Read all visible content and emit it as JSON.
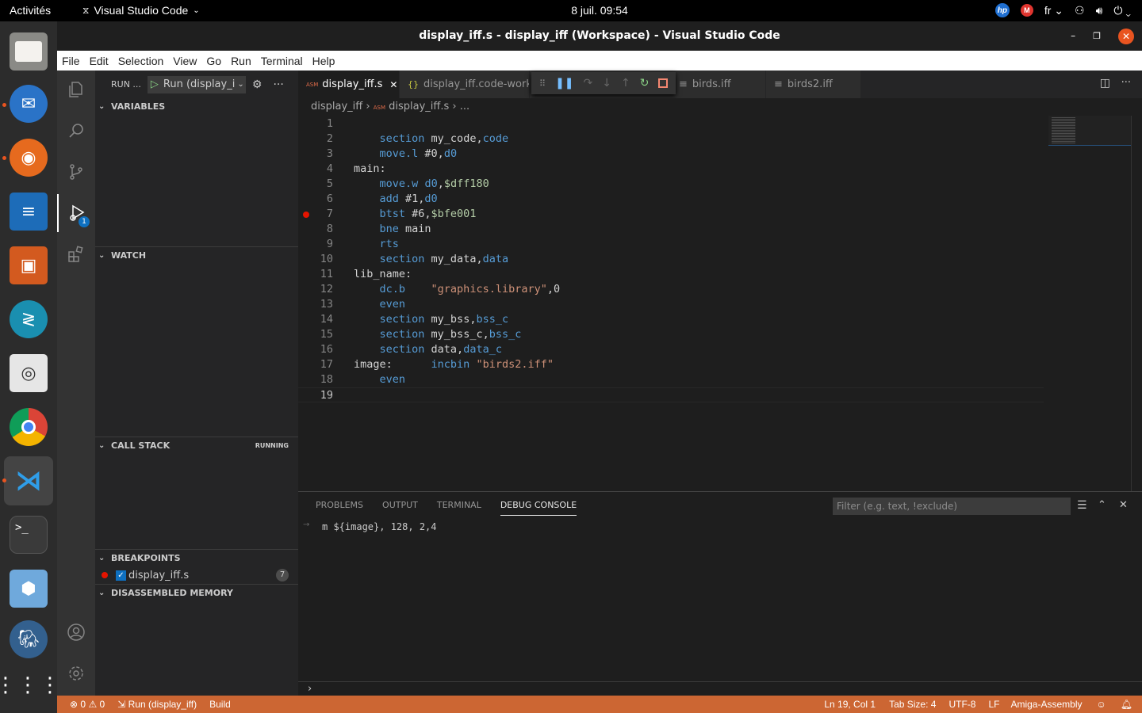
{
  "system_bar": {
    "activities": "Activités",
    "app_name": "Visual Studio Code",
    "clock": "8 juil.  09:54",
    "lang": "fr"
  },
  "dock": {
    "apps": [
      "files-icon",
      "thunderbird-icon",
      "firefox-icon",
      "writer-icon",
      "impress-icon",
      "remote-desktop-icon",
      "document-viewer-icon",
      "chrome-icon",
      "vscode-icon",
      "terminal-icon",
      "virtualbox-icon",
      "pgadmin-icon",
      "show-apps-icon"
    ]
  },
  "window": {
    "title": "display_iff.s - display_iff (Workspace) - Visual Studio Code"
  },
  "menu": [
    "File",
    "Edit",
    "Selection",
    "View",
    "Go",
    "Run",
    "Terminal",
    "Help"
  ],
  "sidebar": {
    "header": "RUN ...",
    "run_config": "Run (display_i",
    "sections": {
      "variables": "VARIABLES",
      "watch": "WATCH",
      "call_stack": "CALL STACK",
      "call_stack_state": "RUNNING",
      "breakpoints": "BREAKPOINTS",
      "disassembled": "DISASSEMBLED MEMORY"
    },
    "breakpoint": {
      "file": "display_iff.s",
      "line": "7"
    }
  },
  "activity_badge": "1",
  "tabs": [
    {
      "label": "display_iff.s",
      "icon": "ASM"
    },
    {
      "label": "display_iff.code-works",
      "icon": "{}"
    },
    {
      "label": "birds.iff"
    },
    {
      "label": "birds2.iff"
    }
  ],
  "breadcrumb": {
    "folder": "display_iff",
    "file": "display_iff.s",
    "tail": "..."
  },
  "code_lines": [
    {
      "n": "1",
      "t": ""
    },
    {
      "n": "2",
      "t": "    section my_code,code"
    },
    {
      "n": "3",
      "t": "    move.l #0,d0"
    },
    {
      "n": "4",
      "t": "main:"
    },
    {
      "n": "5",
      "t": "    move.w d0,$dff180"
    },
    {
      "n": "6",
      "t": "    add #1,d0"
    },
    {
      "n": "7",
      "t": "    btst #6,$bfe001"
    },
    {
      "n": "8",
      "t": "    bne main"
    },
    {
      "n": "9",
      "t": "    rts"
    },
    {
      "n": "10",
      "t": "    section my_data,data"
    },
    {
      "n": "11",
      "t": "lib_name:"
    },
    {
      "n": "12",
      "t": "    dc.b    \"graphics.library\",0"
    },
    {
      "n": "13",
      "t": "    even"
    },
    {
      "n": "14",
      "t": "    section my_bss,bss_c"
    },
    {
      "n": "15",
      "t": "    section my_bss_c,bss_c"
    },
    {
      "n": "16",
      "t": "    section data,data_c"
    },
    {
      "n": "17",
      "t": "image:      incbin \"birds2.iff\""
    },
    {
      "n": "18",
      "t": "    even"
    },
    {
      "n": "19",
      "t": ""
    }
  ],
  "panel": {
    "tabs": [
      "PROBLEMS",
      "OUTPUT",
      "TERMINAL",
      "DEBUG CONSOLE"
    ],
    "filter_placeholder": "Filter (e.g. text, !exclude)",
    "console_line": "m ${image}, 128, 2,4"
  },
  "status": {
    "errors": "0",
    "warnings": "0",
    "run": "Run (display_iff)",
    "build": "Build",
    "position": "Ln 19, Col 1",
    "tab_size": "Tab Size: 4",
    "encoding": "UTF-8",
    "eol": "LF",
    "language": "Amiga-Assembly"
  },
  "colors": {
    "status_bar": "#cc6633",
    "accent": "#e95420"
  }
}
